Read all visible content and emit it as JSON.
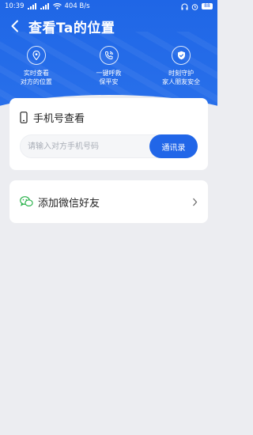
{
  "status_bar": {
    "time": "10:39",
    "network_speed": "404 B/s",
    "battery": "88"
  },
  "header": {
    "title": "查看Ta的位置"
  },
  "features": [
    {
      "icon": "location-pin-icon",
      "line1": "实时查看",
      "line2": "对方的位置"
    },
    {
      "icon": "emergency-phone-icon",
      "line1": "一键呼救",
      "line2": "保平安"
    },
    {
      "icon": "shield-check-icon",
      "line1": "时刻守护",
      "line2": "家人朋友安全"
    }
  ],
  "phone_lookup": {
    "title": "手机号查看",
    "placeholder": "请输入对方手机号码",
    "value": "",
    "contacts_button": "通讯录"
  },
  "wechat": {
    "label": "添加微信好友"
  },
  "colors": {
    "primary": "#2166e8",
    "background": "#ecedf1",
    "wechat_green": "#2bb24c"
  }
}
